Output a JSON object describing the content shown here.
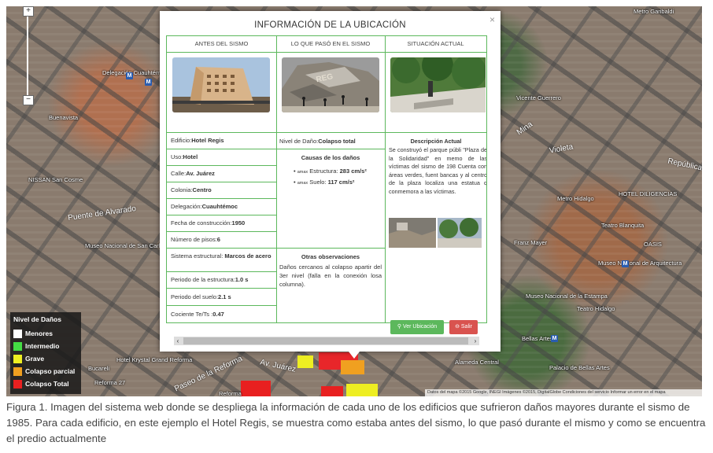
{
  "map": {
    "labels": [
      "Metro Garibaldi",
      "Delegación Cuauhtémoc",
      "Buenavista",
      "NISSAN San Cosme",
      "Metro Hidalgo",
      "Museo Nacional de San Carlos",
      "Museo Nacional de la Estampa",
      "HOTEL DILIGENCIAS",
      "Teatro Blanquita",
      "Teatro Hidalgo",
      "Bellas Artes",
      "Palacio de Bellas Artes",
      "Alameda Central",
      "Hotel Krystal Grand Reforma",
      "Reforma 27",
      "Museo Nacional de Arquitectura",
      "Franz Mayer",
      "OASIS",
      "Vicente Guerrero",
      "Reforma",
      "Bucareli"
    ],
    "roads": [
      "Av. Juárez",
      "Paseo de la Reforma",
      "Puente de Alvarado",
      "Violeta",
      "Mina",
      "República"
    ],
    "attribution": "Datos del mapa ©2015 Google, INEGI Imágenes ©2015, DigitalGlobe   Condiciones del servicio   Informar un error en el mapa",
    "zoom_in": "+",
    "zoom_out": "−"
  },
  "legend": {
    "title": "Nivel de Daños",
    "items": [
      {
        "label": "Menores",
        "color": "#ffffff"
      },
      {
        "label": "Intermedio",
        "color": "#44dd44"
      },
      {
        "label": "Grave",
        "color": "#eeee22"
      },
      {
        "label": "Colapso parcial",
        "color": "#f0a020"
      },
      {
        "label": "Colapso Total",
        "color": "#e82020"
      }
    ]
  },
  "modal": {
    "title": "INFORMACIÓN DE LA UBICACIÓN",
    "close": "×",
    "columns": [
      "ANTES DEL SISMO",
      "LO QUE PASÓ EN EL SISMO",
      "SITUACIÓN ACTUAL"
    ],
    "fields": [
      {
        "label": "Edificio: ",
        "value": "Hotel Regis"
      },
      {
        "label": "Uso: ",
        "value": "Hotel"
      },
      {
        "label": "Calle: ",
        "value": "Av. Juárez"
      },
      {
        "label": "Colonia: ",
        "value": "Centro"
      },
      {
        "label": "Delegación: ",
        "value": "Cuauhtémoc"
      },
      {
        "label": "Fecha de construcción: ",
        "value": "1950"
      },
      {
        "label": "Número de pisos: ",
        "value": "6"
      },
      {
        "label": "Sistema estructural: ",
        "value": "Marcos de acero"
      },
      {
        "label": "Periodo de la estructura: ",
        "value": "1.0 s"
      },
      {
        "label": "Periodo del suelo: ",
        "value": "2.1 s"
      },
      {
        "label": "Cociente Te/Ts : ",
        "value": "0.47"
      }
    ],
    "damage_label": "Nivel de Daño: ",
    "damage_value": "Colapso total",
    "causes_title": "Causas de los daños",
    "causes": [
      {
        "sub": "amax",
        "label": "Estructura: ",
        "value": "283 cm/s²"
      },
      {
        "sub": "amax",
        "label": "Suelo: ",
        "value": "117 cm/s²"
      }
    ],
    "obs_title": "Otras observaciones",
    "obs_text": "Daños cercanos al colapso apartir del 3er nivel (falla en la conexión losa columna).",
    "current_title": "Descripción Actual",
    "current_text": "Se construyó el parque públi \"Plaza de la Solidaridad\" en memo de las víctimas del sismo de 198 Cuenta con áreas verdes, fuent bancas y al centro de la plaza localiza una estatua q conmemora a las víctimas.",
    "btn_view": "Ver Ubicación",
    "btn_exit": "Salir"
  },
  "caption": "Figura 1. Imagen del sistema web donde se despliega la información de cada uno de los edificios que sufrieron daños mayores durante el sismo de 1985. Para cada edificio, en este ejemplo el Hotel Regis, se muestra como estaba antes del sismo, lo que pasó durante el mismo y como se encuentra el predio actualmente"
}
